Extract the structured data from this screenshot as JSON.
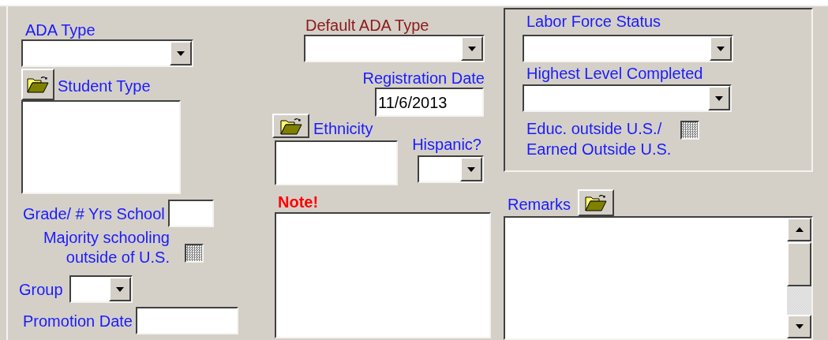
{
  "left": {
    "ada_type": {
      "label": "ADA Type"
    },
    "student_type": {
      "label": "Student Type"
    },
    "grade": {
      "label": "Grade/ # Yrs School"
    },
    "majority_schooling": {
      "label": "Majority schooling\noutside of U.S.",
      "indeterminate": true
    },
    "group": {
      "label": "Group"
    },
    "promotion_date": {
      "label": "Promotion Date"
    }
  },
  "middle": {
    "default_ada_type": {
      "label": "Default ADA Type"
    },
    "registration_date": {
      "label": "Registration Date",
      "value": "11/6/2013"
    },
    "ethnicity": {
      "label": "Ethnicity"
    },
    "hispanic": {
      "label": "Hispanic?"
    },
    "note": {
      "label": "Note!"
    }
  },
  "right": {
    "labor_force_status": {
      "label": "Labor Force Status"
    },
    "highest_level": {
      "label": "Highest Level Completed"
    },
    "educ_outside": {
      "label": "Educ. outside U.S./\nEarned Outside U.S.",
      "indeterminate": true
    },
    "remarks": {
      "label": "Remarks"
    }
  }
}
